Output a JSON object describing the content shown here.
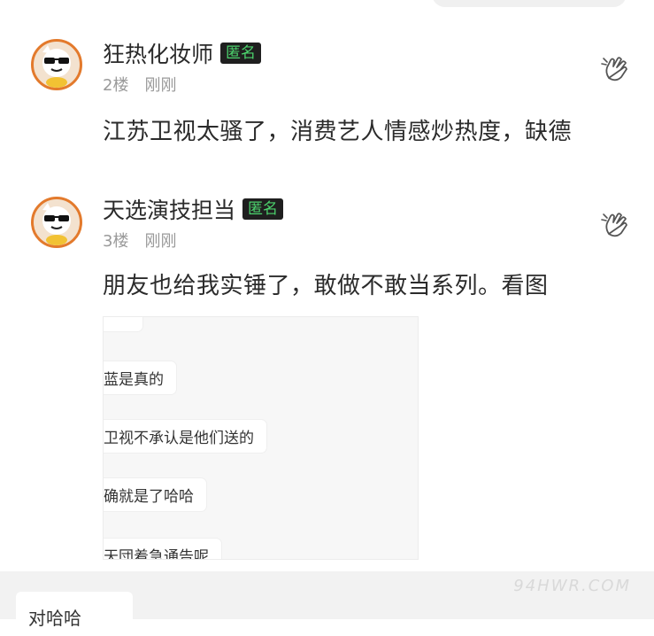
{
  "comments": [
    {
      "username": "狂热化妆师",
      "badge": "匿名",
      "floor": "2楼",
      "time": "刚刚",
      "text": "江苏卫视太骚了，消费艺人情感炒热度，缺德",
      "avatar_icon": "sunglasses-mascot-icon",
      "like_icon": "finger-heart-icon"
    },
    {
      "username": "天选演技担当",
      "badge": "匿名",
      "floor": "3楼",
      "time": "刚刚",
      "text": "朋友也给我实锤了，敢做不敢当系列。看图",
      "avatar_icon": "sunglasses-mascot-icon",
      "like_icon": "finger-heart-icon",
      "image_lines": [
        "蓝是真的",
        "卫视不承认是他们送的",
        "确就是了哈哈",
        "天団着急通告呢"
      ]
    }
  ],
  "bottom_input_text": "对哈哈",
  "watermark": "94HWR.COM",
  "colors": {
    "badge_bg": "#1f1f1f",
    "badge_text": "#4cd36d",
    "avatar_ring": "#e37a2c",
    "meta_text": "#9a9a9a"
  }
}
